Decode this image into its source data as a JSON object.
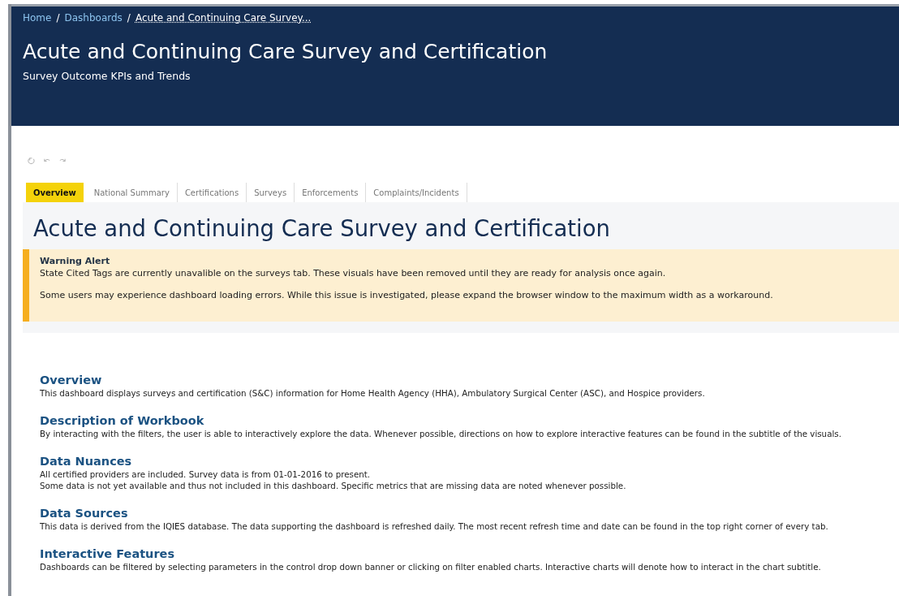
{
  "breadcrumb_separator": "/",
  "breadcrumbs": [
    {
      "label": "Home",
      "current": false
    },
    {
      "label": "Dashboards",
      "current": false
    },
    {
      "label": "Acute and Continuing Care Survey...",
      "current": true
    }
  ],
  "header": {
    "title": "Acute and Continuing Care Survey and Certification",
    "subtitle": "Survey Outcome KPIs and Trends"
  },
  "tabs": [
    {
      "label": "Overview",
      "selected": true
    },
    {
      "label": "National Summary",
      "selected": false
    },
    {
      "label": "Certifications",
      "selected": false
    },
    {
      "label": "Surveys",
      "selected": false
    },
    {
      "label": "Enforcements",
      "selected": false
    },
    {
      "label": "Complaints/Incidents",
      "selected": false
    }
  ],
  "page_title": "Acute and Continuing Care Survey and Certification",
  "alert": {
    "title": "Warning Alert",
    "paragraphs": [
      "State Cited Tags are currently unavalible on the surveys tab. These visuals have been removed until they are ready for analysis once again.",
      "Some users may experience dashboard loading errors. While this issue is investigated, please expand the browser window to the maximum width as a workaround."
    ]
  },
  "sections": [
    {
      "heading": "Overview",
      "lines": [
        "This dashboard displays surveys and certification (S&C) information for Home Health Agency (HHA), Ambulatory Surgical Center (ASC), and Hospice providers."
      ]
    },
    {
      "heading": "Description of Workbook",
      "lines": [
        "By interacting with the filters, the user is able to interactively explore the data. Whenever possible, directions on how to explore interactive features can be found in the subtitle of the visuals."
      ]
    },
    {
      "heading": "Data Nuances",
      "lines": [
        "All certified providers are included. Survey data is from 01-01-2016 to present.",
        "Some data is not yet available and thus not included in this dashboard. Specific metrics that are missing data are noted whenever possible."
      ]
    },
    {
      "heading": "Data Sources",
      "lines": [
        "This data is derived from the IQIES database. The data supporting the dashboard is refreshed daily. The most recent refresh time and date can be found in the top right corner of every tab."
      ]
    },
    {
      "heading": "Interactive Features",
      "lines": [
        "Dashboards can be filtered by selecting parameters in the control drop down banner or clicking on filter enabled charts. Interactive charts will denote how to interact in the chart subtitle."
      ]
    }
  ]
}
